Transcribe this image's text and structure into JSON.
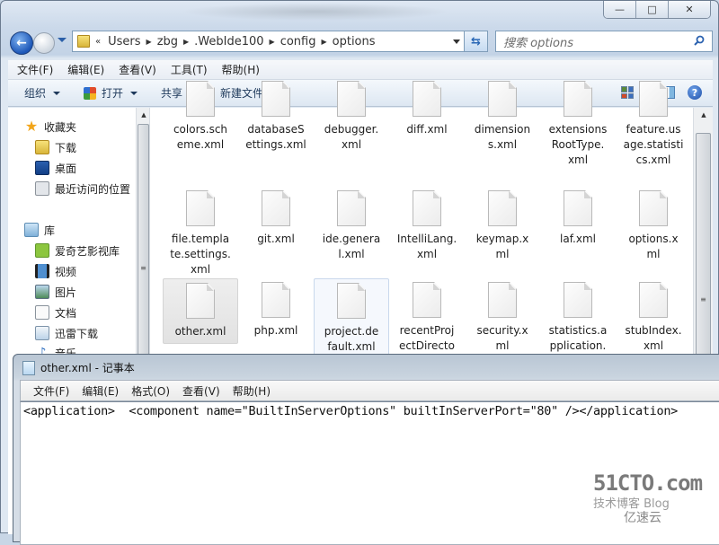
{
  "explorer": {
    "caption_buttons": {
      "minimize": "—",
      "maximize": "□",
      "close": "✕"
    },
    "breadcrumb": {
      "overflow": "«",
      "items": [
        "Users",
        "zbg",
        ".WebIde100",
        "config",
        "options"
      ]
    },
    "search": {
      "placeholder": "搜索 options"
    },
    "menu": [
      "文件(F)",
      "编辑(E)",
      "查看(V)",
      "工具(T)",
      "帮助(H)"
    ],
    "toolbar": {
      "organize": "组织",
      "open": "打开",
      "share": "共享",
      "new_folder": "新建文件夹"
    },
    "nav": {
      "favorites": {
        "label": "收藏夹",
        "items": [
          "下载",
          "桌面",
          "最近访问的位置"
        ]
      },
      "libraries": {
        "label": "库",
        "items": [
          "爱奇艺影视库",
          "视频",
          "图片",
          "文档",
          "迅雷下载",
          "音乐"
        ]
      }
    },
    "files": [
      {
        "name": "colors.sch\neme.xml"
      },
      {
        "name": "databaseS\nettings.xml"
      },
      {
        "name": "debugger.\nxml"
      },
      {
        "name": "diff.xml"
      },
      {
        "name": "dimension\ns.xml"
      },
      {
        "name": "extensions\nRootType.\nxml"
      },
      {
        "name": "feature.us\nage.statisti\ncs.xml"
      },
      {
        "name": "file.templa\nte.settings.\nxml"
      },
      {
        "name": "git.xml"
      },
      {
        "name": "ide.genera\nl.xml"
      },
      {
        "name": "IntelliLang.\nxml"
      },
      {
        "name": "keymap.x\nml"
      },
      {
        "name": "laf.xml"
      },
      {
        "name": "options.x\nml"
      },
      {
        "name": "other.xml",
        "state": "selected"
      },
      {
        "name": "php.xml"
      },
      {
        "name": "project.de\nfault.xml",
        "state": "hover"
      },
      {
        "name": "recentProj\nectDirecto"
      },
      {
        "name": "security.x\nml"
      },
      {
        "name": "statistics.a\npplication."
      },
      {
        "name": "stubIndex.\nxml"
      }
    ]
  },
  "notepad": {
    "title": "other.xml - 记事本",
    "menu": [
      "文件(F)",
      "编辑(E)",
      "格式(O)",
      "查看(V)",
      "帮助(H)"
    ],
    "content": "<application>  <component name=\"BuiltInServerOptions\" builtInServerPort=\"80\" /></application>"
  },
  "watermark": {
    "brand": "51CTO.com",
    "sub": "技术博客  Blog",
    "yisu": "亿速云"
  }
}
